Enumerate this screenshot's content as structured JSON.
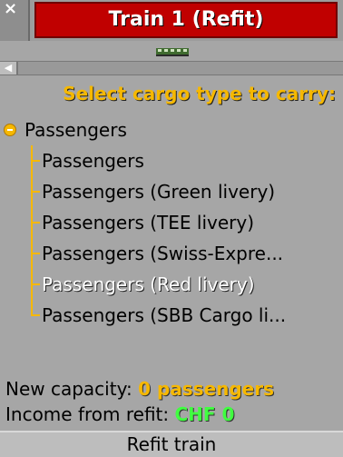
{
  "window": {
    "close_label": "×",
    "title": "Train 1 (Refit)"
  },
  "preview": {
    "sprite_icon": "train-icon"
  },
  "header": {
    "prompt": "Select cargo type to carry:"
  },
  "cargo": {
    "root": "Passengers",
    "options": [
      "Passengers",
      "Passengers (Green livery)",
      "Passengers (TEE livery)",
      "Passengers (Swiss-Expre...",
      "Passengers (Red livery)",
      "Passengers (SBB Cargo li..."
    ],
    "selected_index": 4
  },
  "info": {
    "capacity_label": "New capacity:",
    "capacity_value": "0 passengers",
    "income_label": "Income from refit:",
    "income_value": "CHF 0"
  },
  "actions": {
    "refit_label": "Refit train"
  },
  "colors": {
    "accent_yellow": "#f6b800",
    "title_red": "#c00000",
    "money_green": "#40ff40"
  }
}
